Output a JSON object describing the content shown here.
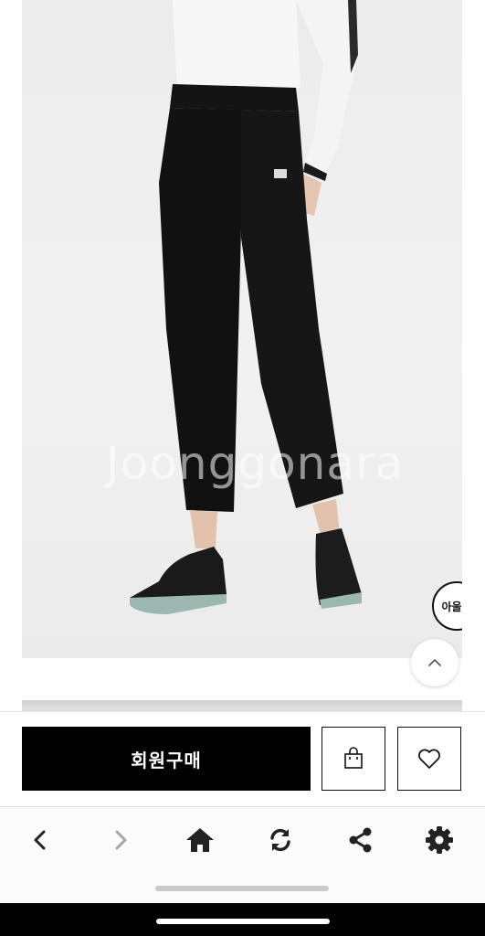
{
  "product": {
    "image_alt": "black flared golf pants",
    "watermark": "Joonggonara",
    "outlet_badge": "아울렛"
  },
  "actions": {
    "buy_label": "회원구매"
  },
  "icons": {
    "scroll_top": "chevron-up-icon",
    "cart": "shopping-bag-icon",
    "wishlist": "heart-icon",
    "back": "chevron-left-icon",
    "forward": "chevron-right-icon",
    "home": "home-icon",
    "refresh": "refresh-icon",
    "share": "share-icon",
    "settings": "gear-icon"
  },
  "colors": {
    "buy_button_bg": "#000000",
    "nav_icon": "#222222",
    "nav_icon_disabled": "#a8a8a8"
  }
}
